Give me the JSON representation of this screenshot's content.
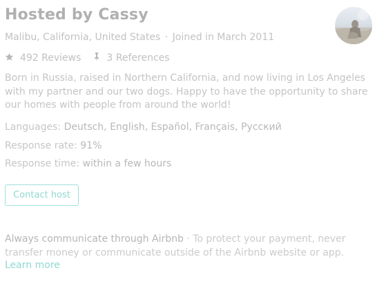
{
  "host": {
    "title": "Hosted by Cassy",
    "location": "Malibu, California, United States",
    "separator": "·",
    "joined": "Joined in March 2011",
    "avatar_icon": "host-avatar"
  },
  "stats": {
    "reviews_icon": "star-icon",
    "reviews": "492 Reviews",
    "references_icon": "reference-icon",
    "references": "3 References"
  },
  "bio": "Born in Russia, raised in Northern California, and now living in Los Angeles with my partner and our two dogs. Happy to have the opportunity to share our homes with people from around the world!",
  "details": {
    "languages_label": "Languages:",
    "languages_value": "Deutsch, English, Español, Français, Русский",
    "response_rate_label": "Response rate:",
    "response_rate_value": "91%",
    "response_time_label": "Response time:",
    "response_time_value": "within a few hours"
  },
  "contact_button": "Contact host",
  "notice": {
    "heading": "Always communicate through Airbnb",
    "separator": "·",
    "body": "To protect your payment, never transfer money or communicate outside of the Airbnb website or app.",
    "link": "Learn more"
  },
  "colors": {
    "accent": "#8fd8d1",
    "text": "#b5b5b5"
  }
}
